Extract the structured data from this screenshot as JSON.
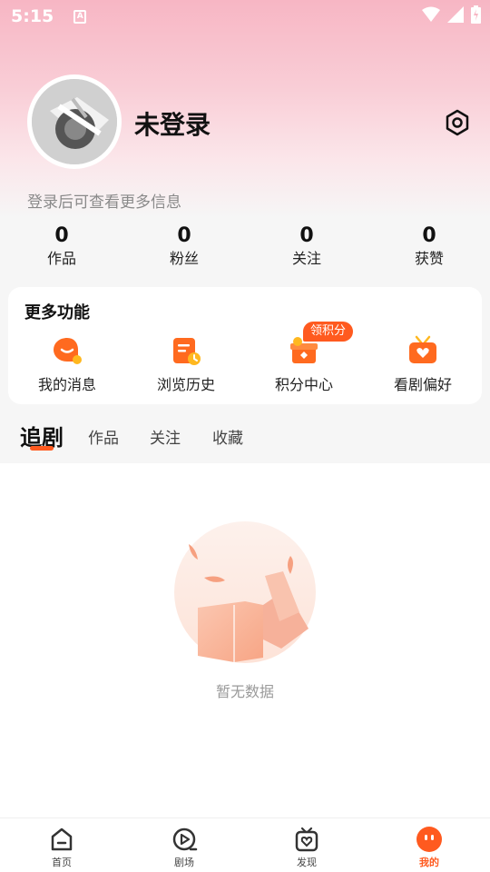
{
  "status_bar": {
    "time": "5:15",
    "indicator": "A"
  },
  "profile": {
    "username": "未登录",
    "login_hint": "登录后可查看更多信息"
  },
  "stats": [
    {
      "value": "0",
      "label": "作品"
    },
    {
      "value": "0",
      "label": "粉丝"
    },
    {
      "value": "0",
      "label": "关注"
    },
    {
      "value": "0",
      "label": "获赞"
    }
  ],
  "more_features": {
    "title": "更多功能",
    "items": [
      {
        "label": "我的消息",
        "icon": "message-icon"
      },
      {
        "label": "浏览历史",
        "icon": "history-icon"
      },
      {
        "label": "积分中心",
        "icon": "points-icon"
      },
      {
        "label": "看剧偏好",
        "icon": "preference-icon"
      }
    ],
    "badge": "领积分"
  },
  "tabs": [
    "追剧",
    "作品",
    "关注",
    "收藏"
  ],
  "empty_state": {
    "text": "暂无数据"
  },
  "bottom_nav": [
    {
      "label": "首页",
      "icon": "home-icon"
    },
    {
      "label": "剧场",
      "icon": "theater-icon"
    },
    {
      "label": "发现",
      "icon": "discover-icon"
    },
    {
      "label": "我的",
      "icon": "profile-icon"
    }
  ],
  "colors": {
    "accent": "#ff5a1f",
    "header_pink": "#f7b6c4"
  }
}
